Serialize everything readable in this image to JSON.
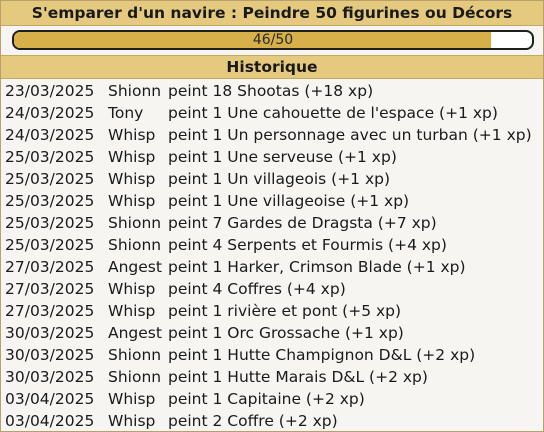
{
  "title": "S'emparer d'un navire : Peindre 50 figurines ou Décors",
  "progress": {
    "current": 46,
    "total": 50,
    "label": "46/50",
    "fraction": 0.92
  },
  "history": {
    "header": "Historique",
    "rows": [
      {
        "date": "23/03/2025",
        "user": "Shionn",
        "action": "peint 18 Shootas (+18 xp)"
      },
      {
        "date": "24/03/2025",
        "user": "Tony",
        "action": "peint 1 Une cahouette de l'espace (+1 xp)"
      },
      {
        "date": "24/03/2025",
        "user": "Whisp",
        "action": "peint 1 Un personnage avec un turban (+1 xp)"
      },
      {
        "date": "25/03/2025",
        "user": "Whisp",
        "action": "peint 1 Une serveuse (+1 xp)"
      },
      {
        "date": "25/03/2025",
        "user": "Whisp",
        "action": "peint 1 Un villageois (+1 xp)"
      },
      {
        "date": "25/03/2025",
        "user": "Whisp",
        "action": "peint 1 Une villageoise (+1 xp)"
      },
      {
        "date": "25/03/2025",
        "user": "Shionn",
        "action": "peint 7 Gardes de Dragsta (+7 xp)"
      },
      {
        "date": "25/03/2025",
        "user": "Shionn",
        "action": "peint 4 Serpents et Fourmis (+4 xp)"
      },
      {
        "date": "27/03/2025",
        "user": "Angest",
        "action": "peint 1 Harker, Crimson Blade (+1 xp)"
      },
      {
        "date": "27/03/2025",
        "user": "Whisp",
        "action": "peint 4 Coffres (+4 xp)"
      },
      {
        "date": "27/03/2025",
        "user": "Whisp",
        "action": "peint 1 rivière et pont (+5 xp)"
      },
      {
        "date": "30/03/2025",
        "user": "Angest",
        "action": "peint 1 Orc Grossache (+1 xp)"
      },
      {
        "date": "30/03/2025",
        "user": "Shionn",
        "action": "peint 1 Hutte Champignon D&L (+2 xp)"
      },
      {
        "date": "30/03/2025",
        "user": "Shionn",
        "action": "peint 1 Hutte Marais D&L (+2 xp)"
      },
      {
        "date": "03/04/2025",
        "user": "Whisp",
        "action": "peint 1 Capitaine (+2 xp)"
      },
      {
        "date": "03/04/2025",
        "user": "Whisp",
        "action": "peint 2 Coffre (+2 xp)"
      }
    ]
  },
  "colors": {
    "header_bg": "#e5c97e",
    "progress_fill": "#d8b04a",
    "panel_bg": "#f6f5f2"
  }
}
